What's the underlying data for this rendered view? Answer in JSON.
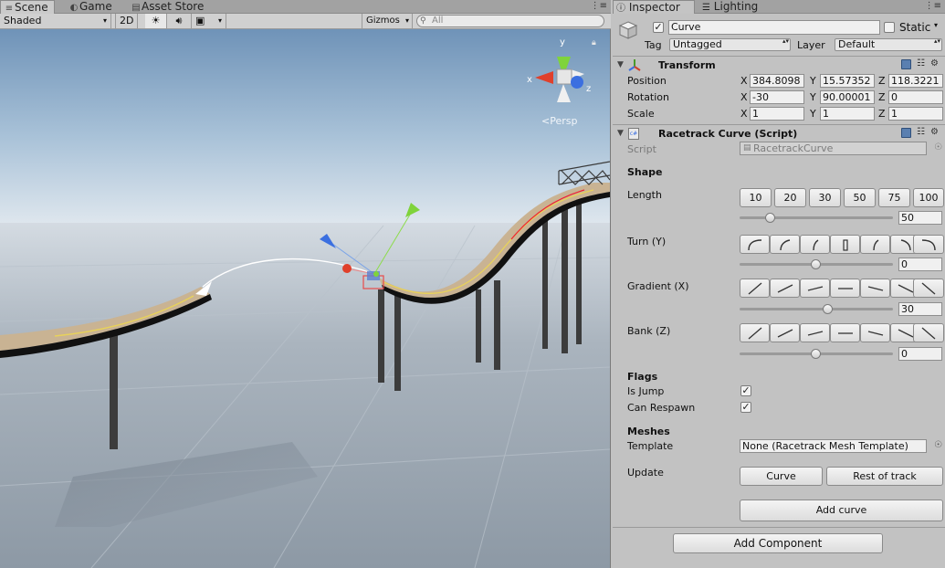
{
  "scene_tabs": [
    {
      "label": "Scene",
      "icon": "grid-icon",
      "active": true
    },
    {
      "label": "Game",
      "icon": "pacman-icon",
      "active": false
    },
    {
      "label": "Asset Store",
      "icon": "shop-icon",
      "active": false
    }
  ],
  "scene_toolbar": {
    "shading_mode": "Shaded",
    "mode_2d": "2D",
    "gizmos_label": "Gizmos",
    "search_placeholder": "All"
  },
  "viewport": {
    "projection_label": "Persp",
    "gizmo_axes": {
      "y": "y",
      "x": "x",
      "z": "z"
    }
  },
  "inspector_tabs": [
    {
      "label": "Inspector",
      "icon": "info-icon",
      "active": true
    },
    {
      "label": "Lighting",
      "icon": "lighting-icon",
      "active": false
    }
  ],
  "object": {
    "name": "Curve",
    "active": true,
    "static_label": "Static",
    "tag_label": "Tag",
    "tag_value": "Untagged",
    "layer_label": "Layer",
    "layer_value": "Default"
  },
  "transform": {
    "title": "Transform",
    "position_label": "Position",
    "rotation_label": "Rotation",
    "scale_label": "Scale",
    "axis_labels": {
      "x": "X",
      "y": "Y",
      "z": "Z"
    },
    "position": {
      "x": "384.8098",
      "y": "15.57352",
      "z": "118.3221"
    },
    "rotation": {
      "x": "-30",
      "y": "90.00001",
      "z": "0"
    },
    "scale": {
      "x": "1",
      "y": "1",
      "z": "1"
    }
  },
  "script_component": {
    "title": "Racetrack Curve (Script)",
    "script_label": "Script",
    "script_value": "RacetrackCurve",
    "shape_header": "Shape",
    "length_label": "Length",
    "length_presets": [
      "10",
      "20",
      "30",
      "50",
      "75",
      "100"
    ],
    "length_value": "50",
    "length_slider_fraction": 0.2,
    "turn_label": "Turn (Y)",
    "turn_value": "0",
    "turn_slider_fraction": 0.5,
    "gradient_label": "Gradient (X)",
    "gradient_value": "30",
    "gradient_slider_fraction": 0.58,
    "bank_label": "Bank (Z)",
    "bank_value": "0",
    "bank_slider_fraction": 0.5,
    "flags_header": "Flags",
    "is_jump_label": "Is Jump",
    "is_jump": true,
    "can_respawn_label": "Can Respawn",
    "can_respawn": true,
    "meshes_header": "Meshes",
    "template_label": "Template",
    "template_value": "None (Racetrack Mesh Template)",
    "update_label": "Update",
    "update_curve_button": "Curve",
    "update_rest_button": "Rest of track",
    "add_curve_button": "Add curve"
  },
  "add_component_button": "Add Component",
  "colors": {
    "sky_top": "#6f93b8",
    "horizon": "#dfe7ee",
    "ground": "#8d99a5",
    "track_wood": "#c9b393",
    "gizmo_y": "#7fd33b",
    "gizmo_x": "#e0402b",
    "gizmo_z": "#3b6fe0"
  }
}
